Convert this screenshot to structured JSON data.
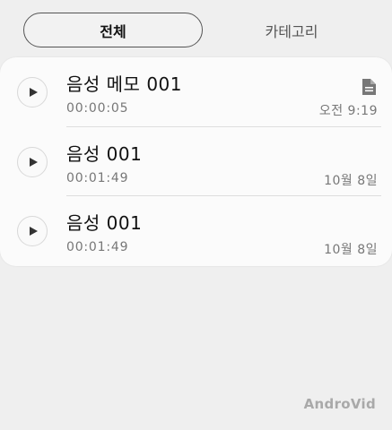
{
  "tabs": [
    {
      "label": "전체",
      "active": true
    },
    {
      "label": "카테고리",
      "active": false
    }
  ],
  "recordings": [
    {
      "title": "음성 메모 001",
      "duration": "00:00:05",
      "date": "오전 9:19",
      "has_file_icon": true
    },
    {
      "title": "음성 001",
      "duration": "00:01:49",
      "date": "10월 8일",
      "has_file_icon": false
    },
    {
      "title": "음성 001",
      "duration": "00:01:49",
      "date": "10월 8일",
      "has_file_icon": false
    }
  ],
  "icons": {
    "play": "play-icon",
    "file": "file-icon"
  },
  "watermark": "AndroVid",
  "colors": {
    "background": "#efefef",
    "card": "#fbfbfb",
    "secondary_text": "#777777",
    "watermark": "#a9a9a9"
  }
}
